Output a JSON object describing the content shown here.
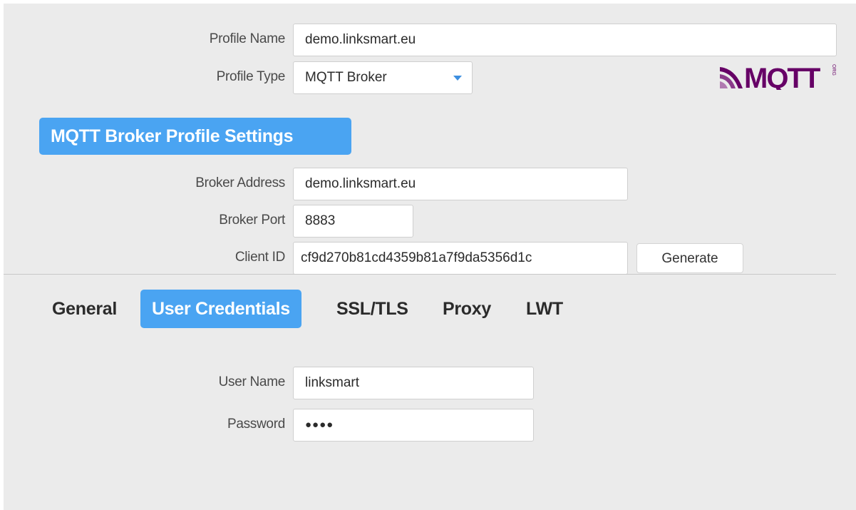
{
  "profile": {
    "name_label": "Profile Name",
    "name_value": "demo.linksmart.eu",
    "type_label": "Profile Type",
    "type_value": "MQTT Broker"
  },
  "logo": {
    "text": "MQTT",
    "suffix": "ORG",
    "color": "#660066"
  },
  "section": {
    "title": "MQTT Broker Profile Settings"
  },
  "broker": {
    "address_label": "Broker Address",
    "address_value": "demo.linksmart.eu",
    "port_label": "Broker Port",
    "port_value": "8883",
    "client_id_label": "Client ID",
    "client_id_value": "cf9d270b81cd4359b81a7f9da5356d1c",
    "generate_label": "Generate"
  },
  "tabs": [
    {
      "label": "General",
      "active": false
    },
    {
      "label": "User Credentials",
      "active": true
    },
    {
      "label": "SSL/TLS",
      "active": false
    },
    {
      "label": "Proxy",
      "active": false
    },
    {
      "label": "LWT",
      "active": false
    }
  ],
  "credentials": {
    "username_label": "User Name",
    "username_value": "linksmart",
    "password_label": "Password",
    "password_value": "●●●●"
  },
  "colors": {
    "accent": "#4aa4f2",
    "panel_bg": "#ebebeb"
  }
}
